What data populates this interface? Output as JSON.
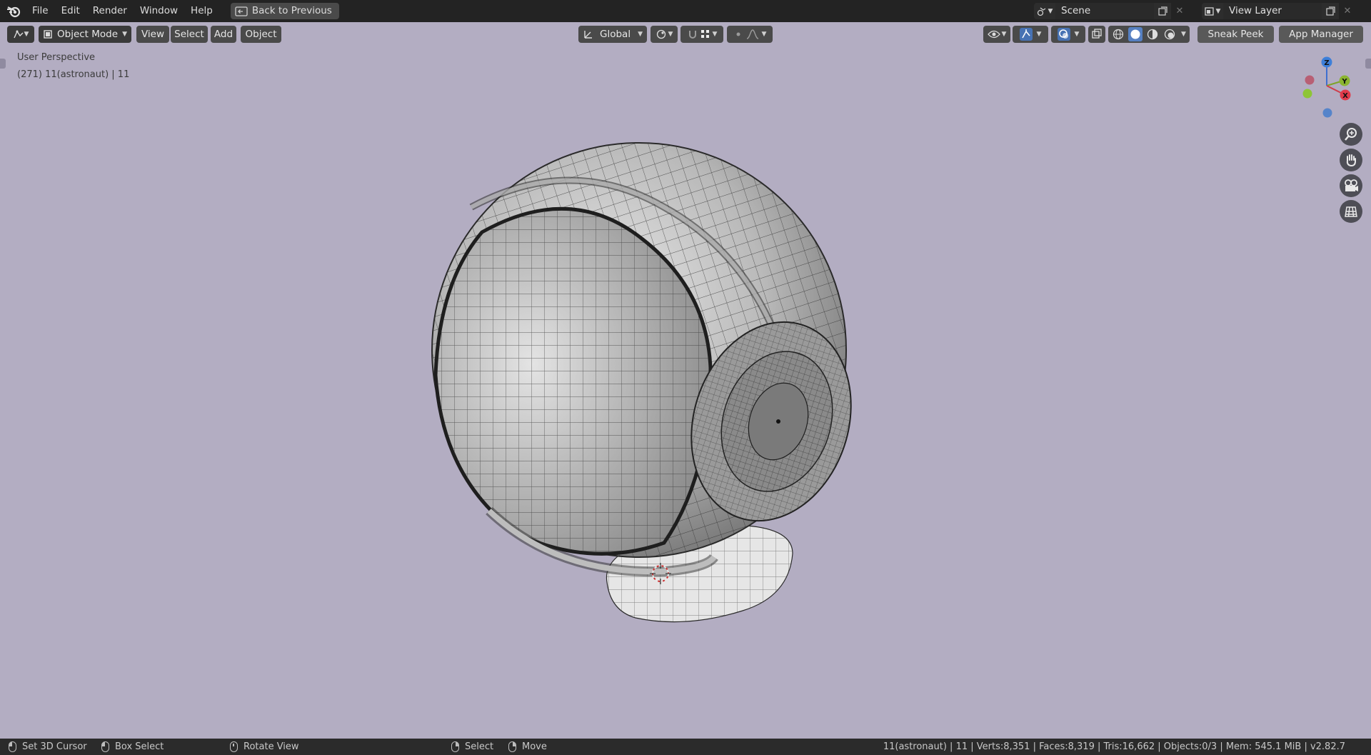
{
  "menu": {
    "items": [
      "File",
      "Edit",
      "Render",
      "Window",
      "Help"
    ],
    "back_button": "Back to Previous"
  },
  "scene": {
    "scene_name": "Scene",
    "view_layer": "View Layer"
  },
  "header": {
    "mode": "Object Mode",
    "menus": [
      "View",
      "Select",
      "Add",
      "Object"
    ],
    "orientation": "Global",
    "sneak_peek": "Sneak Peek",
    "app_manager": "App Manager"
  },
  "viewport": {
    "perspective": "User Perspective",
    "object_info": "(271) 11(astronaut) | 11",
    "axes": {
      "x": "X",
      "y": "Y",
      "z": "Z"
    },
    "background_color": "#b3adc2"
  },
  "statusbar": {
    "set_cursor": "Set 3D Cursor",
    "box_select": "Box Select",
    "rotate_view": "Rotate View",
    "select": "Select",
    "move": "Move",
    "stats": "11(astronaut) | 11 | Verts:8,351 | Faces:8,319 | Tris:16,662 | Objects:0/3 | Mem: 545.1 MiB | v2.82.7"
  },
  "icons": [
    "blender-logo-icon",
    "back-icon",
    "scene-icon",
    "view-layer-icon",
    "editor-type-icon",
    "object-mode-icon",
    "orientation-icon",
    "pivot-icon",
    "snap-icon",
    "proportional-icon",
    "visibility-icon",
    "gizmo-icon",
    "overlay-icon",
    "xray-icon",
    "wireframe-shading-icon",
    "solid-shading-icon",
    "material-shading-icon",
    "rendered-shading-icon",
    "zoom-icon",
    "pan-hand-icon",
    "camera-icon",
    "grid-icon"
  ]
}
